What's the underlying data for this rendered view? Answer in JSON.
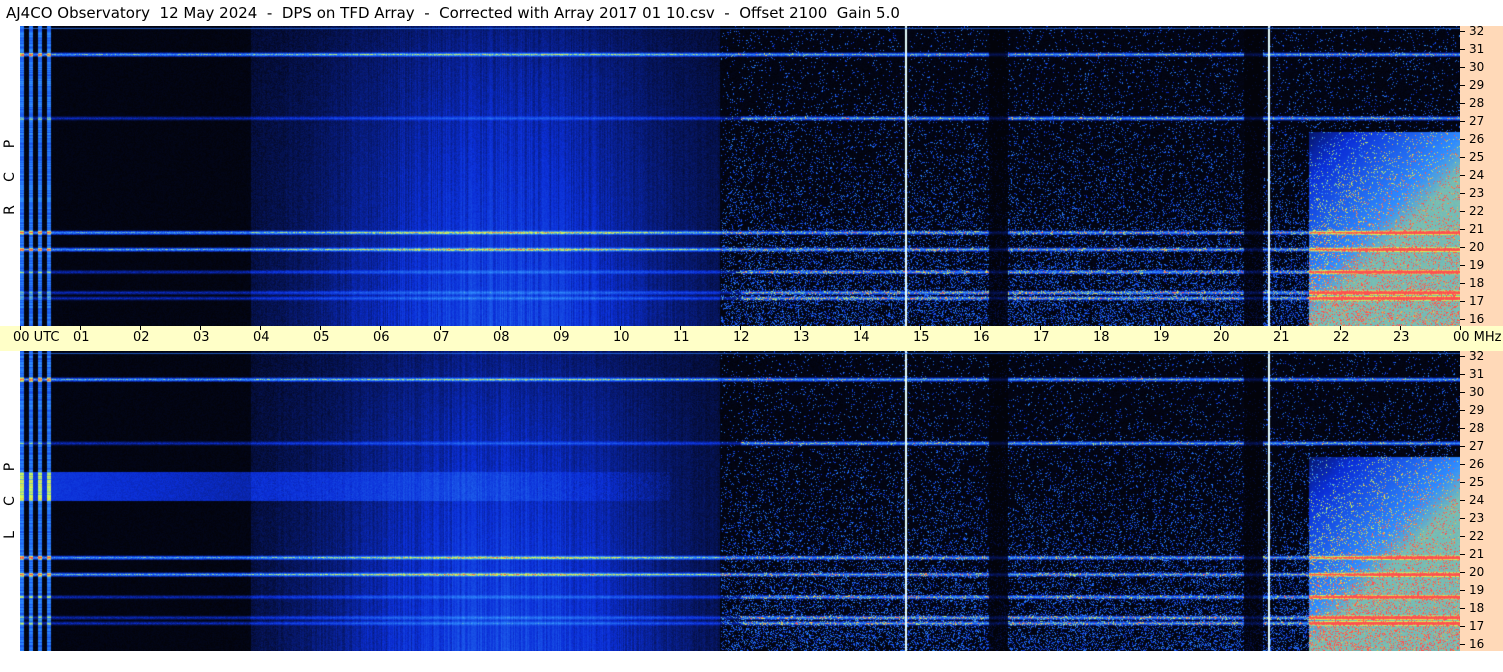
{
  "title": "AJ4CO Observatory  12 May 2024  -  DPS on TFD Array  -  Corrected with Array 2017 01 10.csv  -  Offset 2100  Gain 5.0",
  "panels": [
    {
      "id": "rcp",
      "letters": [
        "P",
        "C",
        "R"
      ]
    },
    {
      "id": "lcp",
      "letters": [
        "P",
        "C",
        "L"
      ]
    }
  ],
  "chart_data": {
    "type": "heatmap",
    "title": "AJ4CO Observatory  12 May 2024  -  DPS on TFD Array  -  Corrected with Array 2017 01 10.csv  -  Offset 2100  Gain 5.0",
    "x": {
      "unit": "UTC",
      "range_hours": [
        0,
        24
      ],
      "tick_labels": [
        "00 UTC",
        "01",
        "02",
        "03",
        "04",
        "05",
        "06",
        "07",
        "08",
        "09",
        "10",
        "11",
        "12",
        "13",
        "14",
        "15",
        "16",
        "17",
        "18",
        "19",
        "20",
        "21",
        "22",
        "23",
        "00 MHz"
      ]
    },
    "y": {
      "unit": "MHz",
      "range": [
        16,
        32
      ],
      "tick_labels": [
        "32",
        "31",
        "30",
        "29",
        "28",
        "27",
        "26",
        "25",
        "24",
        "23",
        "22",
        "21",
        "20",
        "19",
        "18",
        "17",
        "16"
      ]
    },
    "series": [
      {
        "name": "RCP",
        "polarization_label": "R C P"
      },
      {
        "name": "LCP",
        "polarization_label": "L C P"
      }
    ],
    "features": {
      "interference_bands_MHz": [
        27.1,
        17.5,
        17.8,
        18.9,
        20.1,
        21.0,
        30.5
      ],
      "dead_columns_hours": [
        16.3,
        20.55
      ],
      "white_marker_lines_hours": [
        14.75,
        20.8
      ],
      "broadband_emission_hours": [
        5.5,
        11
      ],
      "colors": {
        "background": "#02030a",
        "low": "#0b2fd8",
        "mid": "#2f8cff",
        "high": "#d8ff50",
        "peak": "#ff5050"
      }
    }
  }
}
